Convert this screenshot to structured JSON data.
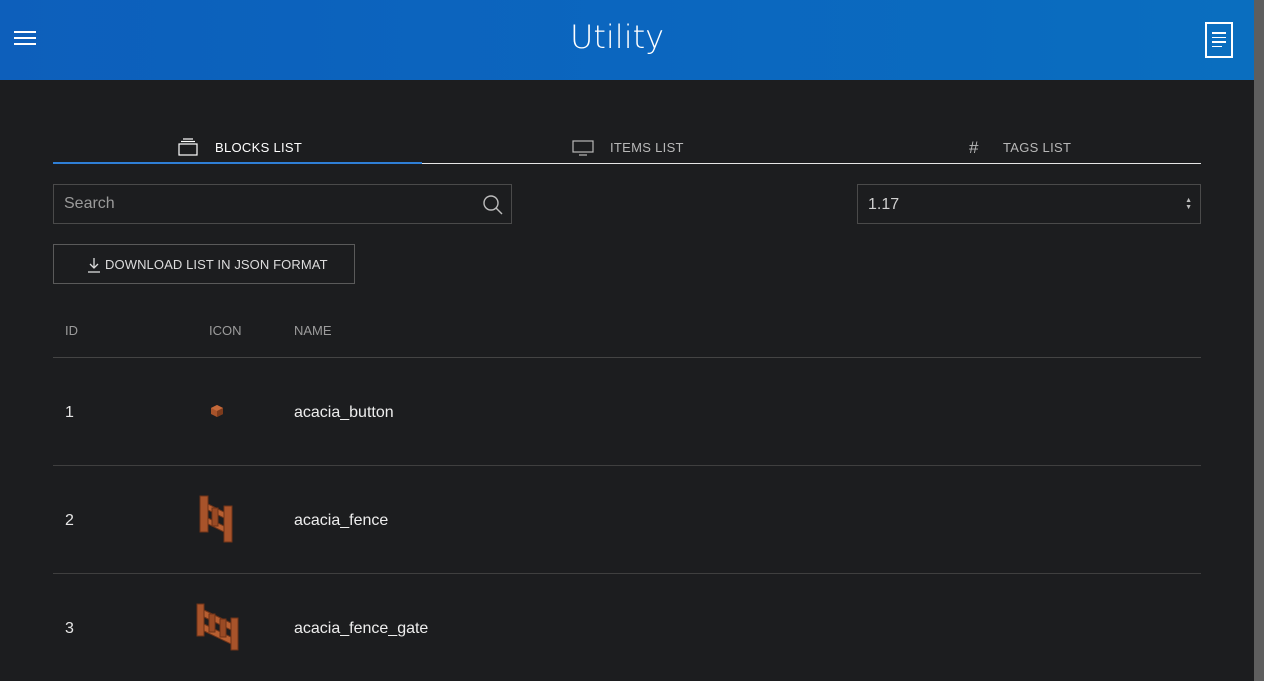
{
  "header": {
    "title": "Utility",
    "menu_icon": "hamburger-menu-icon",
    "doc_icon": "document-icon"
  },
  "tabs": [
    {
      "label": "BLOCKS LIST",
      "icon": "layers-icon",
      "active": true
    },
    {
      "label": "ITEMS LIST",
      "icon": "monitor-icon",
      "active": false
    },
    {
      "label": "TAGS LIST",
      "icon": "hash-icon",
      "active": false
    }
  ],
  "search": {
    "placeholder": "Search",
    "value": ""
  },
  "version_select": {
    "value": "1.17"
  },
  "download": {
    "label": "DOWNLOAD LIST IN JSON FORMAT"
  },
  "table": {
    "headers": [
      "ID",
      "ICON",
      "NAME"
    ],
    "rows": [
      {
        "id": "1",
        "name": "acacia_button",
        "icon": "acacia-button-icon"
      },
      {
        "id": "2",
        "name": "acacia_fence",
        "icon": "acacia-fence-icon"
      },
      {
        "id": "3",
        "name": "acacia_fence_gate",
        "icon": "acacia-fence-gate-icon"
      }
    ]
  },
  "colors": {
    "header_bg": "#0b63bd",
    "page_bg": "#1c1d1f",
    "accent": "#2f7fd6",
    "wood": "#a8532a"
  }
}
